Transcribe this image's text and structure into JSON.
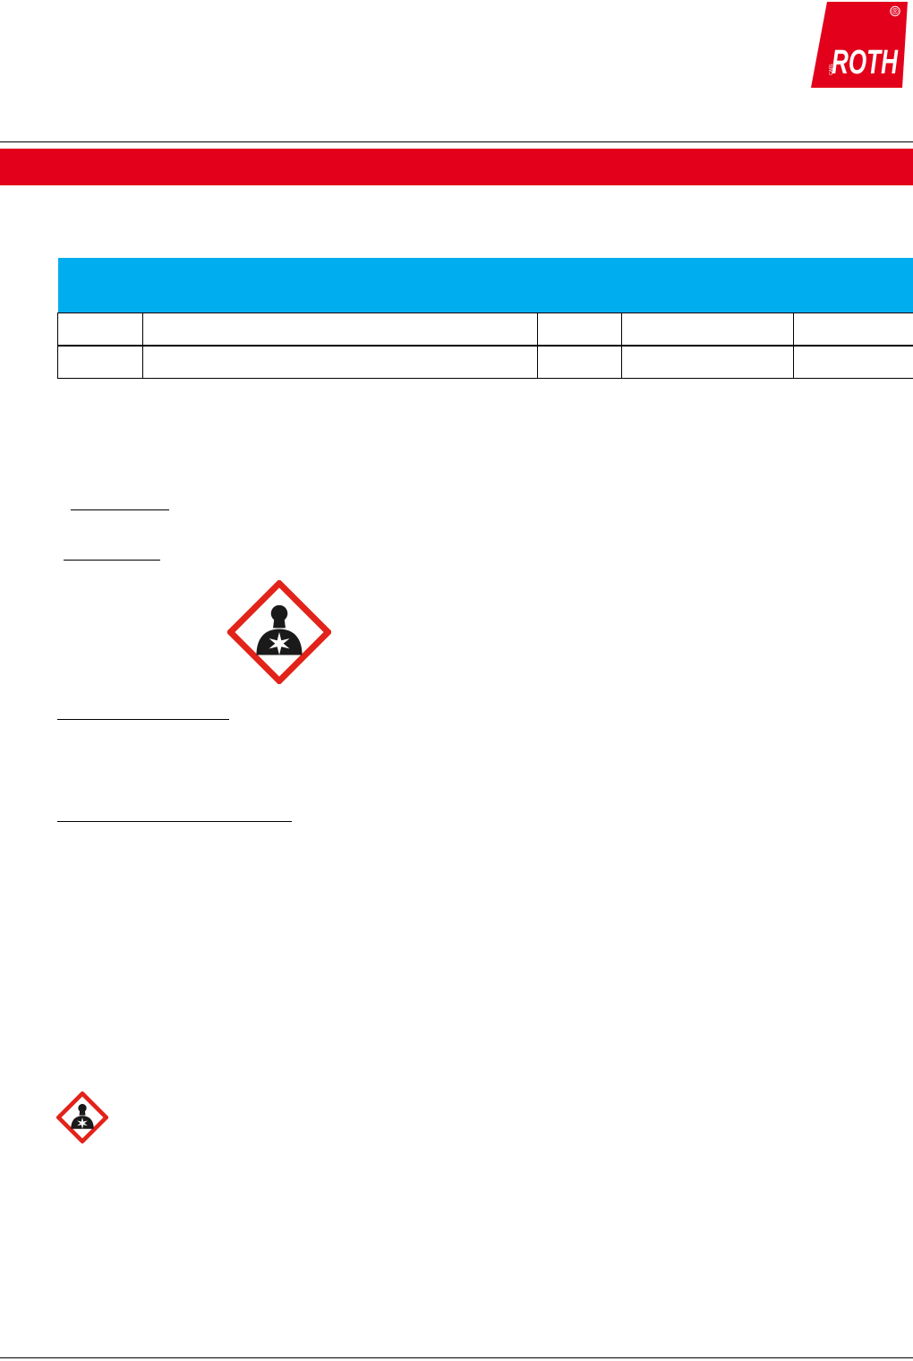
{
  "header": {
    "logo": {
      "brand": "ROTH",
      "prefix": "CARL",
      "registered_mark": "®"
    }
  },
  "colors": {
    "banner_red": "#e2001a",
    "table_header_blue": "#00aeef",
    "pictogram_red": "#e2231a",
    "pictogram_symbol": "#1a1a1a"
  },
  "table": {
    "header": [
      "",
      "",
      "",
      "",
      ""
    ],
    "rows": [
      [
        "",
        "",
        "",
        "",
        ""
      ],
      [
        "",
        "",
        "",
        "",
        ""
      ]
    ]
  },
  "pictograms": [
    {
      "icon": "health-hazard-icon",
      "size": "large"
    },
    {
      "icon": "health-hazard-icon",
      "size": "small"
    }
  ]
}
